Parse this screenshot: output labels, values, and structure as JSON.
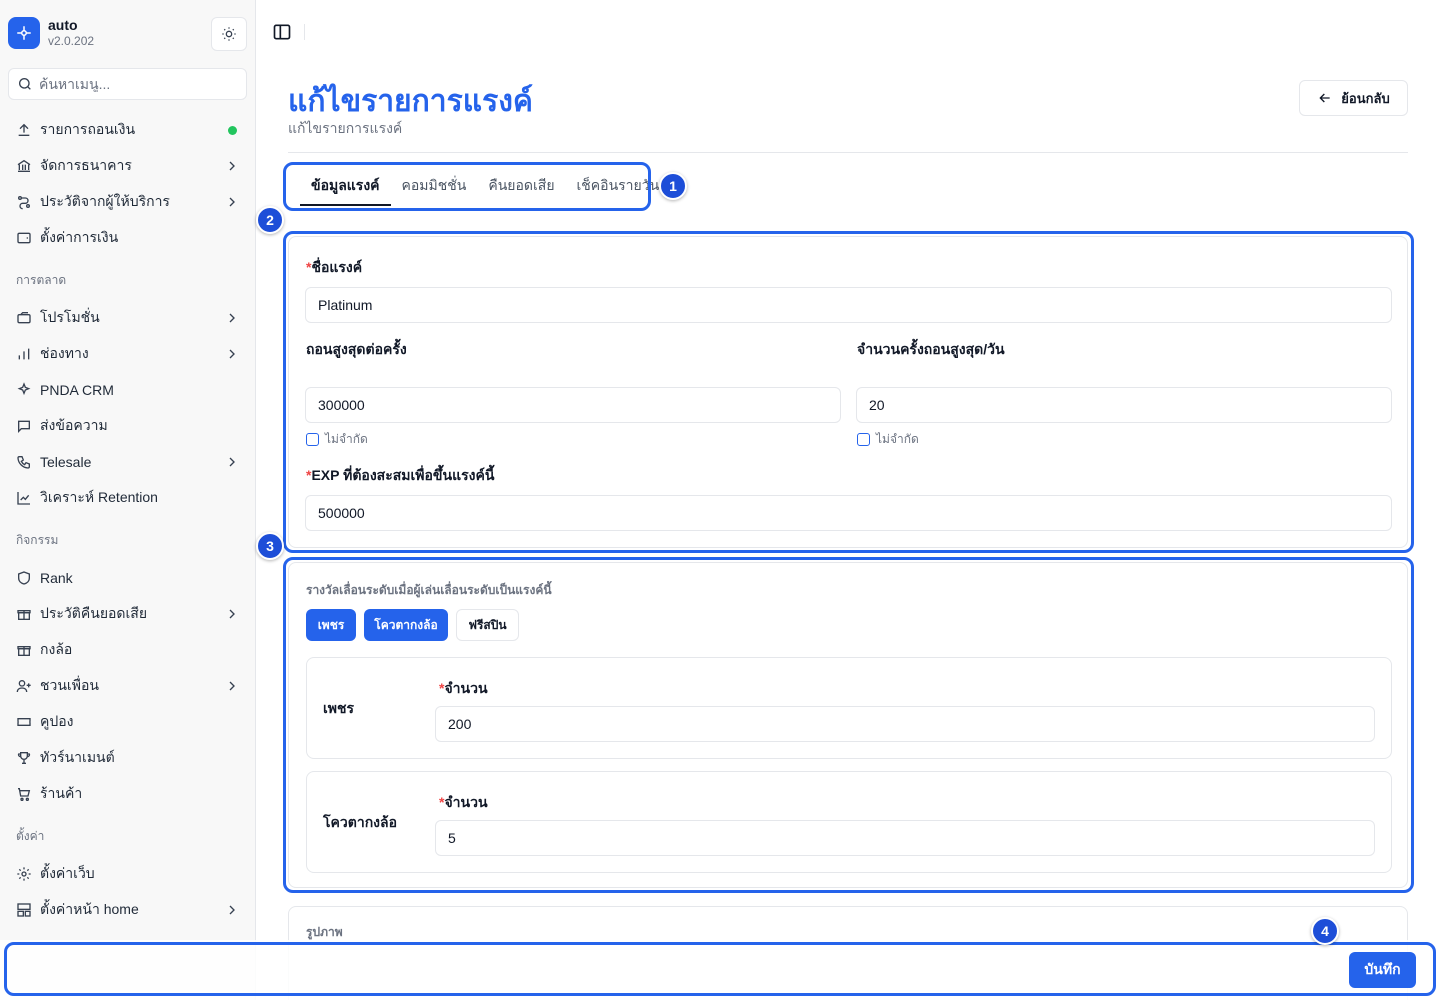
{
  "brand": {
    "name": "auto",
    "version": "v2.0.202"
  },
  "search": {
    "placeholder": "ค้นหาเมนู..."
  },
  "nav": {
    "top": [
      {
        "label": "รายการถอนเงิน",
        "icon": "upload-icon"
      },
      {
        "label": "จัดการธนาคาร",
        "icon": "bank-icon"
      },
      {
        "label": "ประวัติจากผู้ให้บริการ",
        "icon": "flow-icon"
      },
      {
        "label": "ตั้งค่าการเงิน",
        "icon": "wallet-icon"
      }
    ],
    "marketing_title": "การตลาด",
    "marketing": [
      {
        "label": "โปรโมชั่น",
        "icon": "ticket-icon"
      },
      {
        "label": "ช่องทาง",
        "icon": "bars-icon"
      },
      {
        "label": "PNDA CRM",
        "icon": "sparkle-icon"
      },
      {
        "label": "ส่งข้อความ",
        "icon": "message-icon"
      },
      {
        "label": "Telesale",
        "icon": "phone-icon"
      },
      {
        "label": "วิเคราะห์ Retention",
        "icon": "chart-icon"
      }
    ],
    "activity_title": "กิจกรรม",
    "activity": [
      {
        "label": "Rank",
        "icon": "shield-icon"
      },
      {
        "label": "ประวัติคืนยอดเสีย",
        "icon": "gift-icon"
      },
      {
        "label": "กงล้อ",
        "icon": "gift-icon"
      },
      {
        "label": "ชวนเพื่อน",
        "icon": "user-plus-icon"
      },
      {
        "label": "คูปอง",
        "icon": "coupon-icon"
      },
      {
        "label": "ทัวร์นาเมนต์",
        "icon": "trophy-icon"
      },
      {
        "label": "ร้านค้า",
        "icon": "cart-icon"
      }
    ],
    "settings_title": "ตั้งค่า",
    "settings": [
      {
        "label": "ตั้งค่าเว็บ",
        "icon": "gear-icon"
      },
      {
        "label": "ตั้งค่าหน้า home",
        "icon": "layout-icon"
      }
    ]
  },
  "page": {
    "title": "แก้ไขรายการแรงค์",
    "subtitle": "แก้ไขรายการแรงค์",
    "back_label": "ย้อนกลับ"
  },
  "tabs": [
    "ข้อมูลแรงค์",
    "คอมมิชชั่น",
    "คืนยอดเสีย",
    "เช็คอินรายวัน"
  ],
  "form": {
    "rank_name_label": "ชื่อแรงค์",
    "rank_name_value": "Platinum",
    "max_withdraw_label": "ถอนสูงสุดต่อครั้ง",
    "max_withdraw_value": "300000",
    "max_times_label": "จำนวนครั้งถอนสูงสุด/วัน",
    "max_times_value": "20",
    "unlimited_label": "ไม่จำกัด",
    "exp_label": "EXP ที่ต้องสะสมเพื่อขึ้นแรงค์นี้",
    "exp_value": "500000"
  },
  "rewards": {
    "section_title": "รางวัลเลื่อนระดับเมื่อผู้เล่นเลื่อนระดับเป็นแรงค์นี้",
    "options": [
      "เพชร",
      "โควตากงล้อ",
      "ฟรีสปิน"
    ],
    "amount_label": "จำนวน",
    "items": [
      {
        "name": "เพชร",
        "value": "200"
      },
      {
        "name": "โควตากงล้อ",
        "value": "5"
      }
    ]
  },
  "image_section": {
    "title": "รูปภาพ"
  },
  "footer": {
    "save_label": "บันทึก"
  },
  "callouts": [
    "1",
    "2",
    "3",
    "4"
  ],
  "colors": {
    "accent": "#2563eb",
    "status_online": "#22c55e",
    "required": "#ef4444"
  }
}
